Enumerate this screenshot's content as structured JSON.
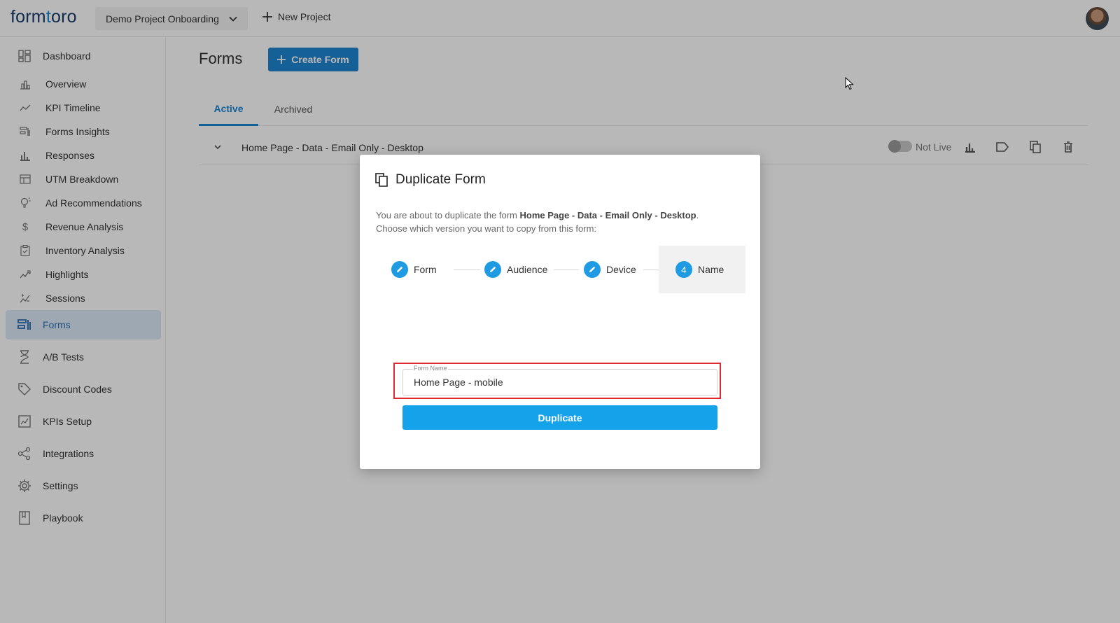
{
  "topbar": {
    "logo_prefix": "form",
    "logo_t": "t",
    "logo_suffix": "oro",
    "project_name": "Demo Project Onboarding",
    "new_project_label": "New Project"
  },
  "sidebar": {
    "items": [
      {
        "label": "Dashboard",
        "icon": "dashboard-icon"
      },
      {
        "label": "Overview",
        "icon": "bar-chart-icon"
      },
      {
        "label": "KPI Timeline",
        "icon": "trend-line-icon"
      },
      {
        "label": "Forms Insights",
        "icon": "forms-insights-icon"
      },
      {
        "label": "Responses",
        "icon": "responses-bars-icon"
      },
      {
        "label": "UTM Breakdown",
        "icon": "table-icon"
      },
      {
        "label": "Ad Recommendations",
        "icon": "lightbulb-icon"
      },
      {
        "label": "Revenue Analysis",
        "icon": "dollar-icon"
      },
      {
        "label": "Inventory Analysis",
        "icon": "clipboard-icon"
      },
      {
        "label": "Highlights",
        "icon": "sparkline-icon"
      },
      {
        "label": "Sessions",
        "icon": "sessions-icon"
      },
      {
        "label": "Forms",
        "icon": "forms-icon"
      },
      {
        "label": "A/B Tests",
        "icon": "hourglass-icon"
      },
      {
        "label": "Discount Codes",
        "icon": "tag-icon"
      },
      {
        "label": "KPIs Setup",
        "icon": "kpi-setup-icon"
      },
      {
        "label": "Integrations",
        "icon": "share-icon"
      },
      {
        "label": "Settings",
        "icon": "gear-icon"
      },
      {
        "label": "Playbook",
        "icon": "book-icon"
      }
    ]
  },
  "main": {
    "title": "Forms",
    "create_label": "Create Form",
    "tabs": [
      {
        "label": "Active"
      },
      {
        "label": "Archived"
      }
    ],
    "row": {
      "name": "Home Page - Data - Email Only - Desktop",
      "status": "Not Live"
    }
  },
  "modal": {
    "title": "Duplicate Form",
    "desc_prefix": "You are about to duplicate the form ",
    "desc_form": "Home Page - Data - Email Only - Desktop",
    "desc_suffix": ".",
    "desc_line2": "Choose which version you want to copy from this form:",
    "steps": [
      {
        "label": "Form",
        "state": "done"
      },
      {
        "label": "Audience",
        "state": "done"
      },
      {
        "label": "Device",
        "state": "done"
      },
      {
        "label": "Name",
        "state": "current",
        "number": "4"
      }
    ],
    "field_label": "Form Name",
    "field_value": "Home Page - mobile",
    "duplicate_label": "Duplicate"
  },
  "colors": {
    "accent": "#1f86d3",
    "step_blue": "#1e9be3",
    "button_blue": "#14a3ea",
    "highlight_red": "#e0282e"
  }
}
